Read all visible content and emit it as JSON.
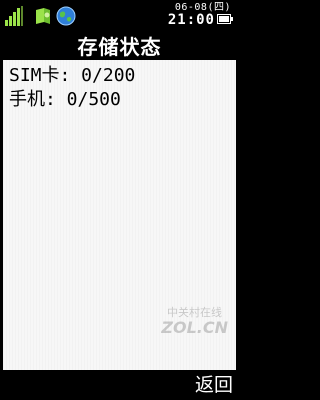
{
  "status_bar": {
    "date": "06-08(四)",
    "time": "21:00",
    "icons": [
      "signal-icon",
      "message-icon",
      "globe-icon",
      "battery-icon"
    ]
  },
  "title": "存储状态",
  "storage": {
    "sim_line": "SIM卡: 0/200",
    "phone_line": "手机: 0/500"
  },
  "softkey": {
    "back": "返回"
  },
  "watermark": {
    "cn": "中关村在线",
    "en": "ZOL.CN"
  },
  "colors": {
    "background": "#000000",
    "content_bg": "#f7f7f7",
    "text": "#000000",
    "bar_text": "#ffffff",
    "signal": "#9be34a"
  }
}
